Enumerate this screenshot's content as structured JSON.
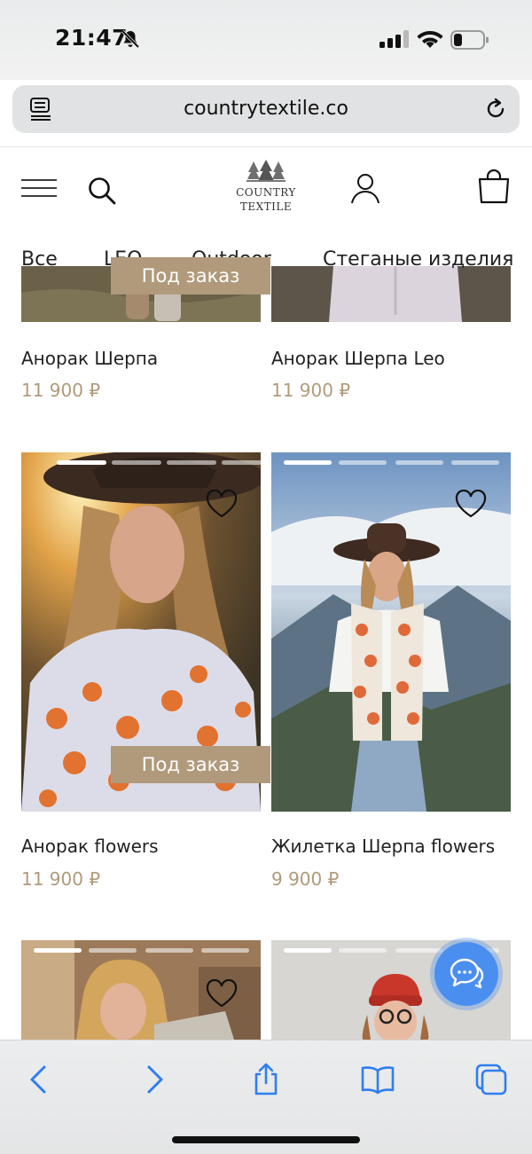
{
  "status_bar": {
    "time": "21:47",
    "icons": [
      "mute-icon",
      "signal-icon",
      "wifi-icon",
      "battery-icon"
    ]
  },
  "browser": {
    "url": "countrytextile.co",
    "icons": [
      "reader-icon",
      "reload-icon"
    ]
  },
  "header": {
    "logo_line1": "COUNTRY",
    "logo_line2": "TEXTILE",
    "icons": [
      "menu-icon",
      "search-icon",
      "account-icon",
      "cart-icon"
    ]
  },
  "categories": [
    "Все",
    "LEO",
    "Outdoor",
    "Стеганые изделия"
  ],
  "products": [
    {
      "name": "Анорак Шерпа",
      "price": "11 900 ₽",
      "badge": "Под заказ"
    },
    {
      "name": "Анорак Шерпа Leo",
      "price": "11 900 ₽",
      "badge": ""
    },
    {
      "name": "Анорак flowers",
      "price": "11 900 ₽",
      "badge": "Под заказ"
    },
    {
      "name": "Жилетка Шерпа flowers",
      "price": "9 900 ₽",
      "badge": ""
    }
  ],
  "colors": {
    "accent": "#b09a7b",
    "chat": "#4a8ff0",
    "toolbar_icons": "#2f7ef0"
  },
  "toolbar": {
    "icons": [
      "back-icon",
      "forward-icon",
      "share-icon",
      "bookmarks-icon",
      "tabs-icon"
    ]
  }
}
